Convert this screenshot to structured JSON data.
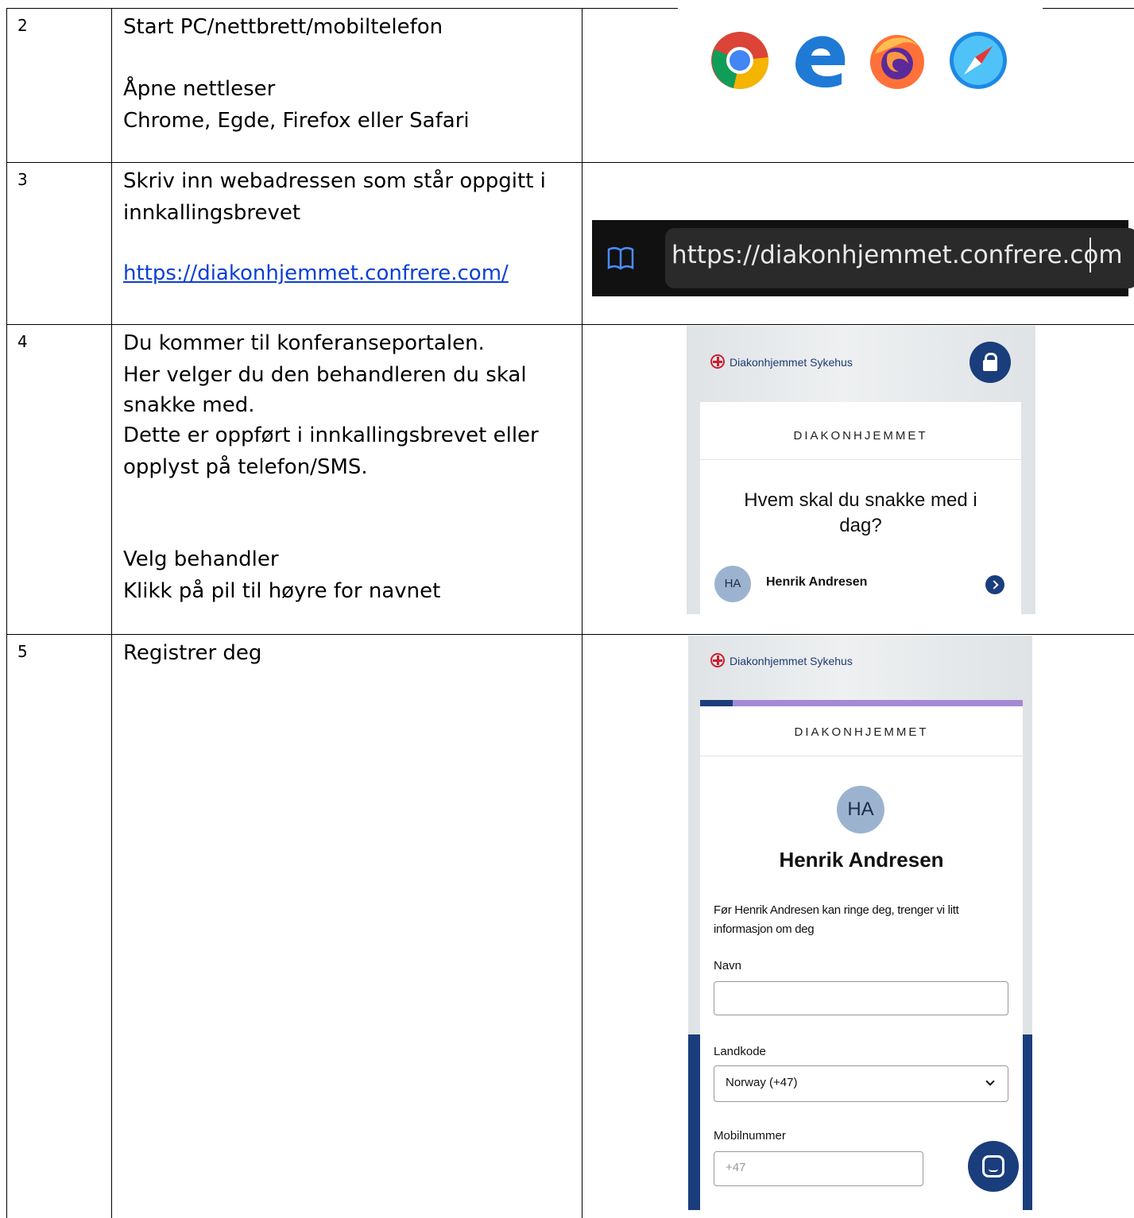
{
  "rows": [
    {
      "number": "2",
      "lines": [
        "Start PC/nettbrett/mobiltelefon",
        "Åpne nettleser",
        "Chrome, Egde, Firefox eller Safari"
      ]
    },
    {
      "number": "3",
      "lines": [
        "Skriv inn webadressen som står oppgitt i",
        "innkallingsbrevet"
      ],
      "link": "https://diakonhjemmet.confrere.com/"
    },
    {
      "number": "4",
      "lines": [
        "Du kommer til konferanseportalen.",
        "Her velger du den behandleren du skal",
        "snakke med.",
        "Dette er oppført i innkallingsbrevet eller",
        "opplyst på telefon/SMS.",
        "Velg behandler",
        "Klikk på pil til høyre for navnet"
      ]
    },
    {
      "number": "5",
      "lines": [
        "Registrer deg"
      ]
    }
  ],
  "browsers": [
    "chrome-icon",
    "edge-icon",
    "firefox-icon",
    "safari-icon"
  ],
  "urlbar": {
    "url": "https://diakonhjemmet.confrere.com"
  },
  "portal": {
    "brand": "Diakonhjemmet Sykehus",
    "org": "DIAKONHJEMMET",
    "question": "Hvem skal du snakke med i dag?",
    "provider_initials": "HA",
    "provider_name": "Henrik Andresen"
  },
  "register": {
    "brand": "Diakonhjemmet Sykehus",
    "org": "DIAKONHJEMMET",
    "initials": "HA",
    "name": "Henrik Andresen",
    "intro": "Før Henrik Andresen kan ringe deg, trenger vi litt informasjon om deg",
    "name_label": "Navn",
    "country_label": "Landkode",
    "country_value": "Norway (+47)",
    "mobile_label": "Mobilnummer",
    "mobile_placeholder": "+47"
  },
  "colors": {
    "link": "#0b3fd4",
    "navy": "#1a3d7c",
    "purple": "#a48ad4",
    "avatar": "#9cb3cf"
  }
}
